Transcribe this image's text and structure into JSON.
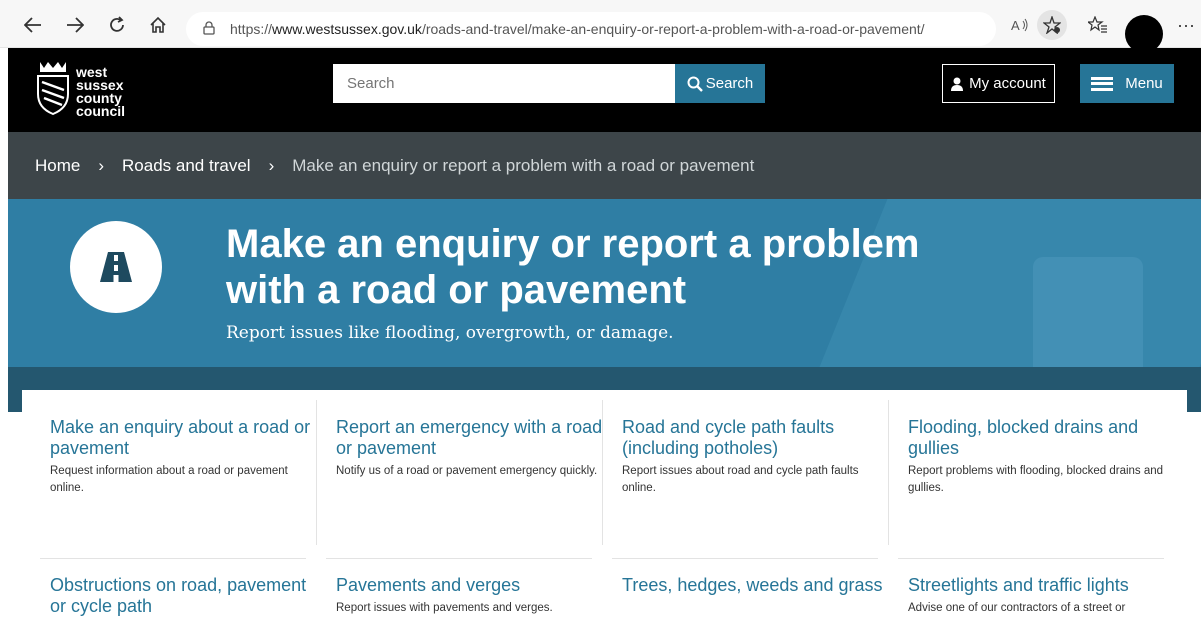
{
  "browser": {
    "url_prefix": "https://",
    "url_domain": "www.westsussex.gov.uk",
    "url_path": "/roads-and-travel/make-an-enquiry-or-report-a-problem-with-a-road-or-pavement/"
  },
  "header": {
    "logo_lines": [
      "west",
      "sussex",
      "county",
      "council"
    ],
    "search_placeholder": "Search",
    "search_button": "Search",
    "account_button": "My account",
    "menu_button": "Menu"
  },
  "breadcrumb": {
    "home": "Home",
    "section": "Roads and travel",
    "current": "Make an enquiry or report a problem with a road or pavement"
  },
  "hero": {
    "title": "Make an enquiry or report a problem with a road or pavement",
    "subtitle": "Report issues like flooding, overgrowth, or damage."
  },
  "cards": [
    {
      "title": "Make an enquiry about a road or pavement",
      "desc": "Request information about a road or pavement online."
    },
    {
      "title": "Report an emergency with a road or pavement",
      "desc": "Notify us of a road or pavement emergency quickly."
    },
    {
      "title": "Road and cycle path faults (including potholes)",
      "desc": "Report issues about road and cycle path faults online."
    },
    {
      "title": "Flooding, blocked drains and gullies",
      "desc": "Report problems with flooding, blocked drains and gullies."
    },
    {
      "title": "Obstructions on road, pavement or cycle path",
      "desc": ""
    },
    {
      "title": "Pavements and verges",
      "desc": "Report issues with pavements and verges."
    },
    {
      "title": "Trees, hedges, weeds and grass",
      "desc": ""
    },
    {
      "title": "Streetlights and traffic lights",
      "desc": "Advise one of our contractors of a street or"
    }
  ],
  "colors": {
    "brand_blue": "#267597",
    "hero_blue": "#2f7ea4",
    "breadcrumb_bg": "#3d4549",
    "header_bg": "#000000"
  }
}
